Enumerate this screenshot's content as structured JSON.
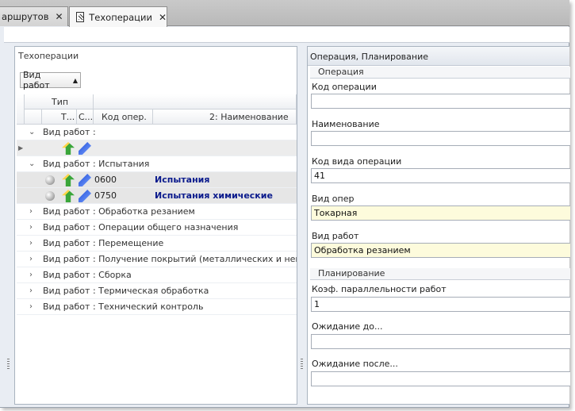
{
  "tabs": [
    {
      "label": "аршрутов",
      "close": "✕"
    },
    {
      "label": "Техоперации",
      "close": "✕"
    }
  ],
  "left_panel": {
    "title": "Техоперации",
    "group_button": {
      "label": "Вид работ",
      "arrow": "▲"
    },
    "columns": {
      "group_header": "Тип",
      "col_t": "Т...",
      "col_s": "С...",
      "col_code": "Код опер.",
      "col_name": "2: Наименование"
    },
    "groups": [
      {
        "label": "Вид работ :",
        "expanded": true
      },
      {
        "label": "Вид работ : Испытания",
        "expanded": true
      },
      {
        "label": "Вид работ : Обработка резанием",
        "expanded": false
      },
      {
        "label": "Вид работ : Операции общего назначения",
        "expanded": false
      },
      {
        "label": "Вид работ : Перемещение",
        "expanded": false
      },
      {
        "label": "Вид работ : Получение покрытий (металлических и неметалли",
        "expanded": false
      },
      {
        "label": "Вид работ : Сборка",
        "expanded": false
      },
      {
        "label": "Вид работ : Термическая обработка",
        "expanded": false
      },
      {
        "label": "Вид работ : Технический контроль",
        "expanded": false
      }
    ],
    "rows": [
      {
        "code": "0600",
        "name": "Испытания"
      },
      {
        "code": "0750",
        "name": "Испытания химические"
      }
    ]
  },
  "right_panel": {
    "title": "Операция, Планирование",
    "section_operation": "Операция",
    "section_planning": "Планирование",
    "fields": {
      "op_code": {
        "label": "Код операции",
        "value": ""
      },
      "name": {
        "label": "Наименование",
        "value": ""
      },
      "op_kind_code": {
        "label": "Код вида операции",
        "value": "41"
      },
      "op_type": {
        "label": "Вид опер",
        "value": "Токарная"
      },
      "work_kind": {
        "label": "Вид работ",
        "value": "Обработка резанием"
      },
      "parallel_coef": {
        "label": "Коэф. параллельности работ",
        "value": "1"
      },
      "wait_before": {
        "label": "Ожидание до...",
        "value": ""
      },
      "wait_after": {
        "label": "Ожидание после...",
        "value": ""
      }
    }
  },
  "colors": {
    "required_field_bg": "#fdfbdc",
    "bold_name": "#0a1a8c"
  }
}
